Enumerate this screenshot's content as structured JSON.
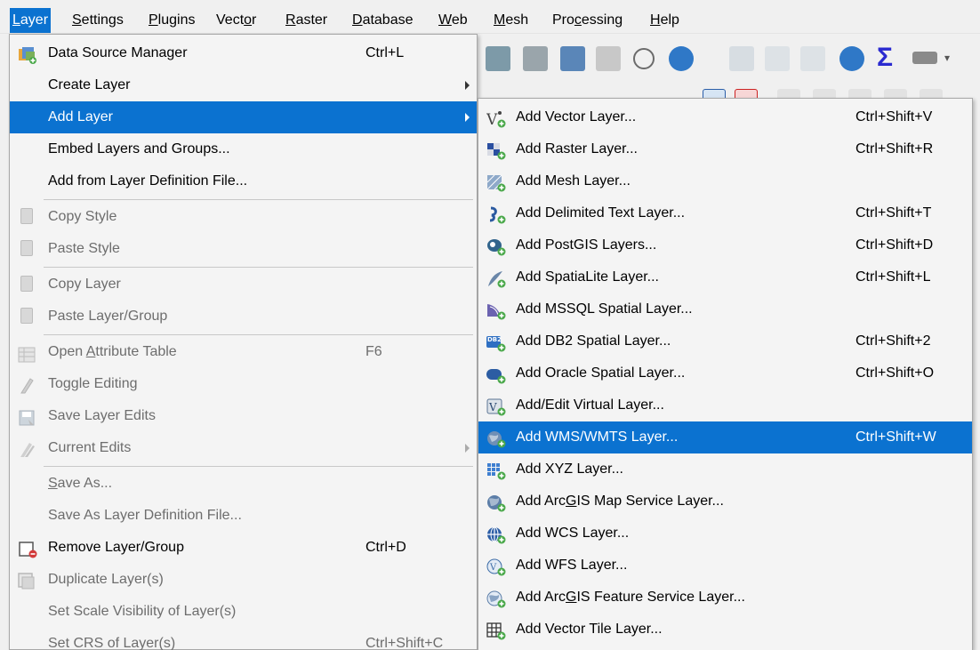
{
  "menubar": {
    "items": [
      {
        "label": "Layer",
        "underline": "L",
        "rest": "ayer"
      },
      {
        "label": "Settings",
        "underline": "S",
        "rest": "ettings"
      },
      {
        "label": "Plugins",
        "underline": "P",
        "rest": "lugins"
      },
      {
        "label": "Vector",
        "pre": "Vect",
        "underline": "o",
        "rest": "r"
      },
      {
        "label": "Raster",
        "underline": "R",
        "rest": "aster"
      },
      {
        "label": "Database",
        "underline": "D",
        "rest": "atabase"
      },
      {
        "label": "Web",
        "underline": "W",
        "rest": "eb"
      },
      {
        "label": "Mesh",
        "underline": "M",
        "rest": "esh"
      },
      {
        "label": "Processing",
        "pre": "Pro",
        "underline": "c",
        "rest": "essing"
      },
      {
        "label": "Help",
        "underline": "H",
        "rest": "elp"
      }
    ]
  },
  "layer_menu": {
    "items": [
      {
        "label": "Data Source Manager",
        "shortcut": "Ctrl+L",
        "icon": "data-source-manager-icon"
      },
      {
        "label": "Create Layer",
        "submenu": true
      },
      {
        "label": "Add Layer",
        "submenu": true
      },
      {
        "label": "Embed Layers and Groups..."
      },
      {
        "label": "Add from Layer Definition File..."
      },
      {
        "label": "Copy Style",
        "icon": "copy-style-icon"
      },
      {
        "label": "Paste Style",
        "icon": "paste-style-icon"
      },
      {
        "label": "Copy Layer",
        "icon": "copy-layer-icon"
      },
      {
        "label": "Paste Layer/Group",
        "icon": "paste-layer-icon"
      },
      {
        "label_pre": "Open ",
        "label_u": "A",
        "label_post": "ttribute Table",
        "shortcut": "F6",
        "icon": "attribute-table-icon"
      },
      {
        "label": "Toggle Editing",
        "icon": "pencil-icon"
      },
      {
        "label": "Save Layer Edits",
        "icon": "save-edits-icon"
      },
      {
        "label": "Current Edits",
        "submenu": true,
        "icon": "current-edits-icon"
      },
      {
        "label_pre": "",
        "label_u": "S",
        "label_post": "ave As..."
      },
      {
        "label": "Save As Layer Definition File..."
      },
      {
        "label": "Remove Layer/Group",
        "shortcut": "Ctrl+D",
        "icon": "remove-layer-icon"
      },
      {
        "label": "Duplicate Layer(s)",
        "icon": "duplicate-layer-icon"
      },
      {
        "label": "Set Scale Visibility of Layer(s)"
      },
      {
        "label": "Set CRS of Layer(s)",
        "shortcut": "Ctrl+Shift+C"
      }
    ]
  },
  "add_layer_menu": {
    "items": [
      {
        "label": "Add Vector Layer...",
        "shortcut": "Ctrl+Shift+V",
        "icon": "vector-layer-icon"
      },
      {
        "label": "Add Raster Layer...",
        "shortcut": "Ctrl+Shift+R",
        "icon": "raster-layer-icon"
      },
      {
        "label": "Add Mesh Layer...",
        "icon": "mesh-layer-icon"
      },
      {
        "label": "Add Delimited Text Layer...",
        "shortcut": "Ctrl+Shift+T",
        "icon": "delimited-text-icon"
      },
      {
        "label": "Add PostGIS Layers...",
        "shortcut": "Ctrl+Shift+D",
        "icon": "postgis-icon"
      },
      {
        "label": "Add SpatiaLite Layer...",
        "shortcut": "Ctrl+Shift+L",
        "icon": "spatialite-icon"
      },
      {
        "label": "Add MSSQL Spatial Layer...",
        "icon": "mssql-icon"
      },
      {
        "label": "Add DB2 Spatial Layer...",
        "shortcut": "Ctrl+Shift+2",
        "icon": "db2-icon",
        "icon_text": "DB2"
      },
      {
        "label": "Add Oracle Spatial Layer...",
        "shortcut": "Ctrl+Shift+O",
        "icon": "oracle-icon"
      },
      {
        "label": "Add/Edit Virtual Layer...",
        "icon": "virtual-layer-icon"
      },
      {
        "label": "Add WMS/WMTS Layer...",
        "shortcut": "Ctrl+Shift+W",
        "icon": "wms-icon"
      },
      {
        "label": "Add XYZ Layer...",
        "icon": "xyz-icon"
      },
      {
        "label_pre": "Add Arc",
        "label_u": "G",
        "label_post": "IS Map Service Layer...",
        "icon": "arcgis-map-icon"
      },
      {
        "label": "Add WCS Layer...",
        "icon": "wcs-icon"
      },
      {
        "label": "Add WFS Layer...",
        "icon": "wfs-icon"
      },
      {
        "label_pre": "Add Arc",
        "label_u": "G",
        "label_post": "IS Feature Service Layer...",
        "icon": "arcgis-feature-icon"
      },
      {
        "label": "Add Vector Tile Layer...",
        "icon": "vector-tile-icon"
      }
    ]
  },
  "colors": {
    "highlight": "#0b72d0",
    "disabled_text": "#6d6d6d",
    "menu_bg": "#f4f4f4"
  }
}
